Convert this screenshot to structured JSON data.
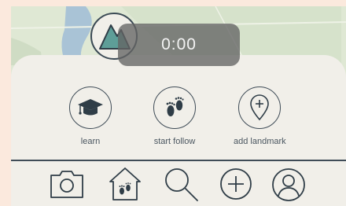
{
  "timer": {
    "elapsed": "0:00"
  },
  "actions": [
    {
      "label": "learn",
      "icon": "graduation-cap-icon"
    },
    {
      "label": "start follow",
      "icon": "footprints-icon"
    },
    {
      "label": "add landmark",
      "icon": "map-pin-plus-icon"
    }
  ],
  "tab_bar": [
    {
      "icon": "camera-icon"
    },
    {
      "icon": "home-footprints-icon"
    },
    {
      "icon": "search-icon"
    },
    {
      "icon": "add-circle-icon"
    },
    {
      "icon": "profile-icon"
    }
  ],
  "colors": {
    "panel": "#f1efe9",
    "map": "#dfe8d4",
    "water": "#a9c3d6",
    "accent_teal": "#5e9e98",
    "outline": "#3f4c57",
    "timer_bg": "#646464"
  }
}
